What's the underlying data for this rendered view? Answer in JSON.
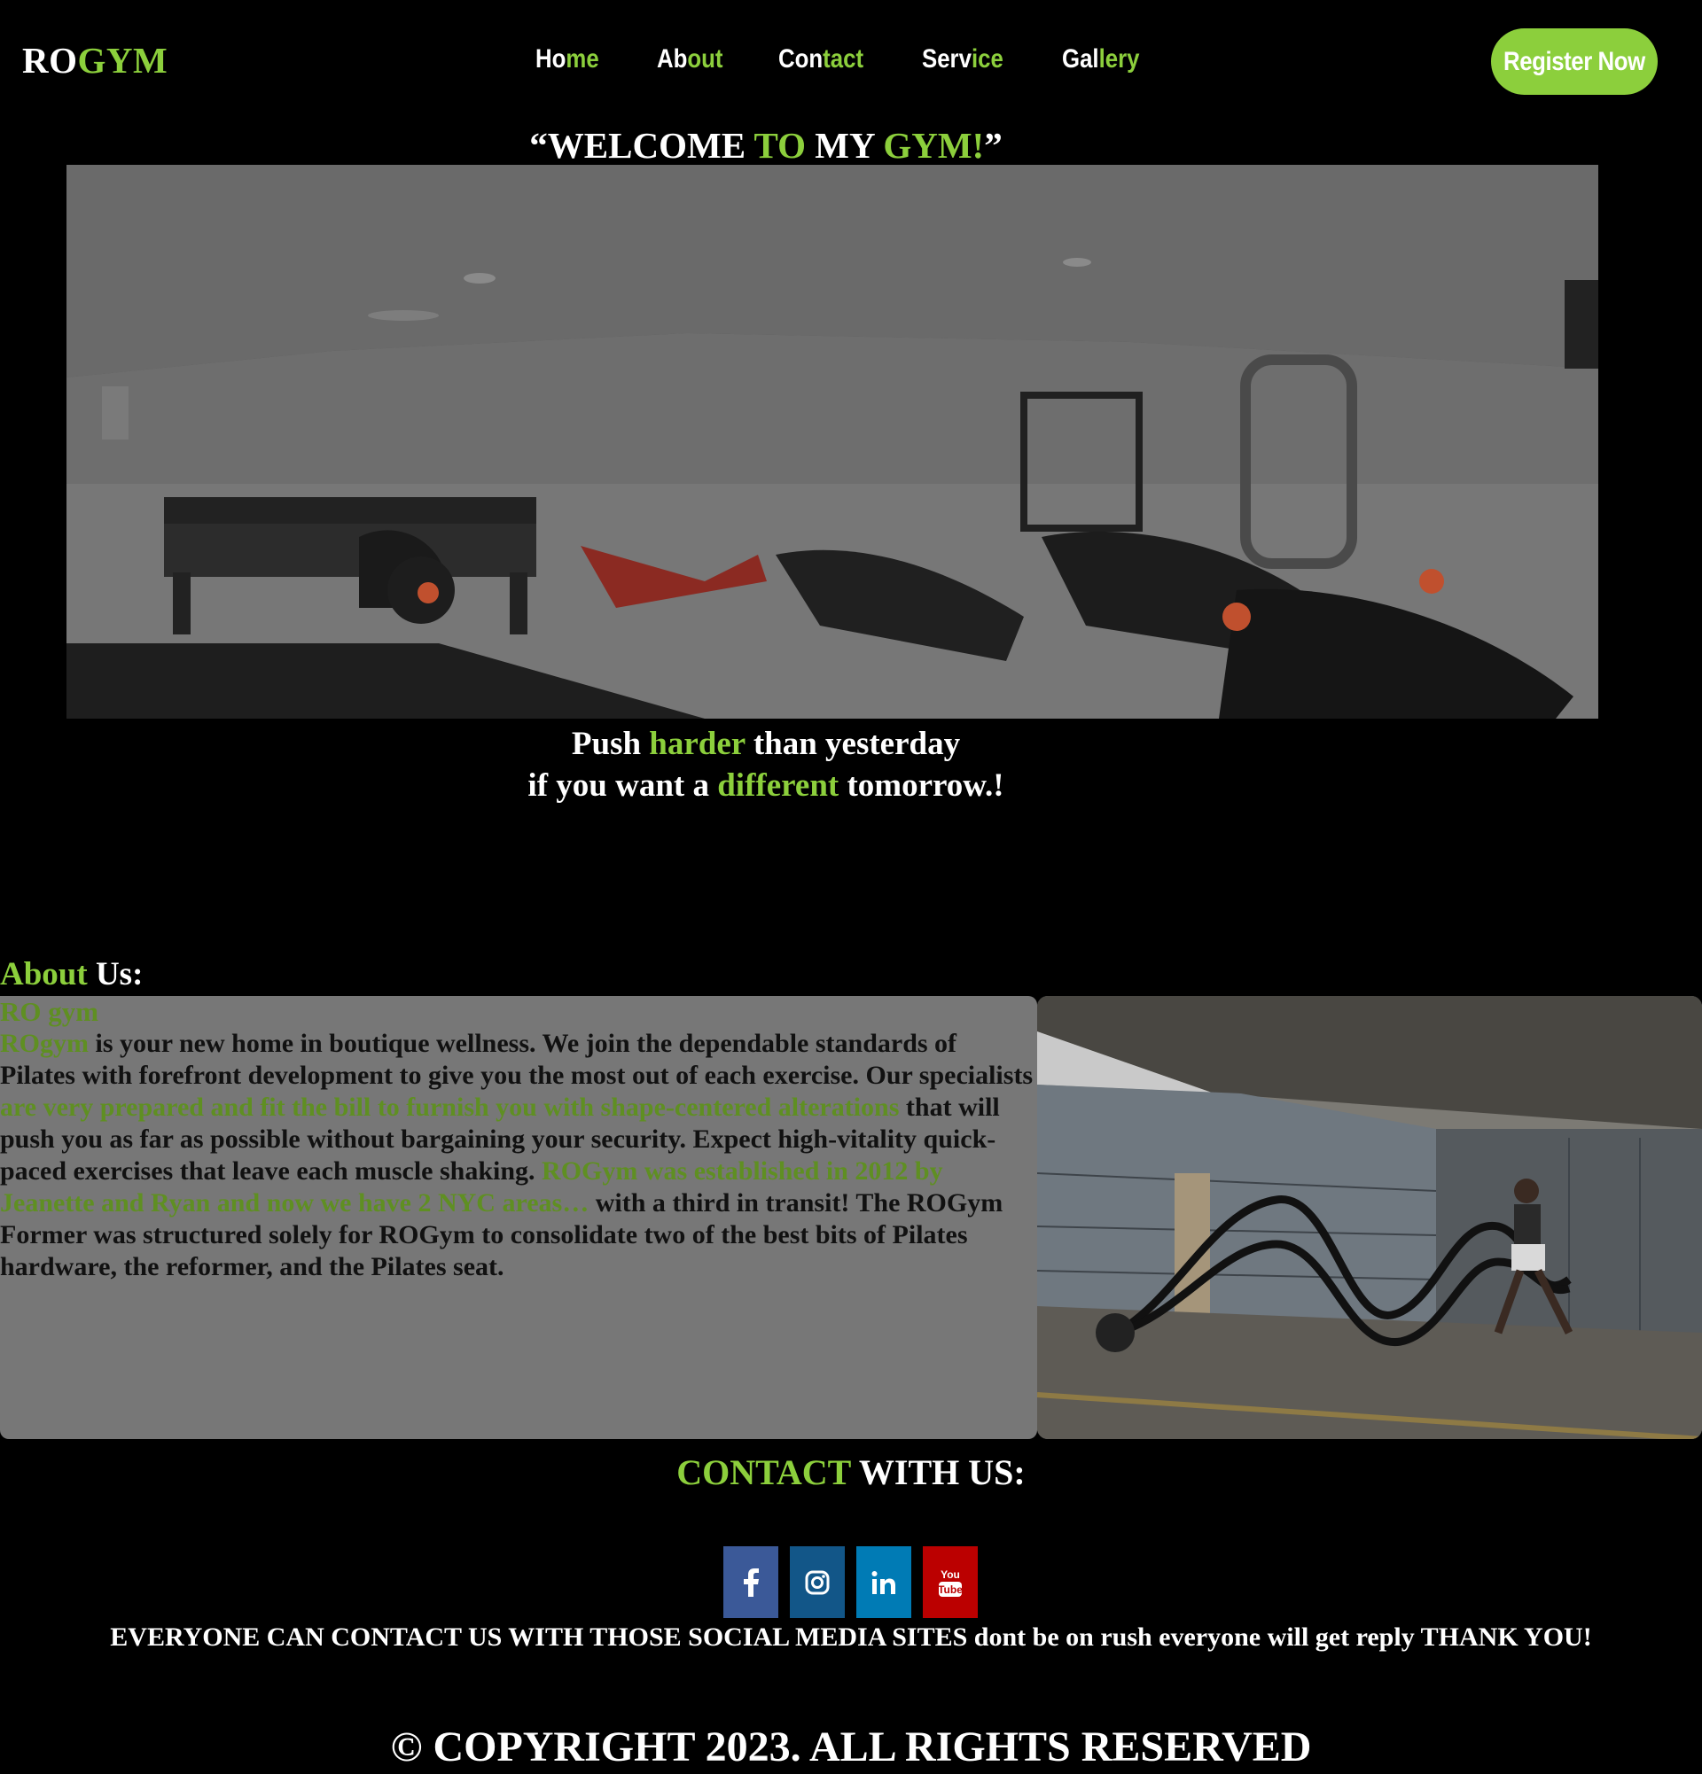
{
  "header": {
    "logo": {
      "part1": "RO",
      "part2": "GYM"
    },
    "nav": [
      {
        "a": "Ho",
        "b": "me"
      },
      {
        "a": "Ab",
        "b": "out"
      },
      {
        "a": "Con",
        "b": "tact"
      },
      {
        "a": "Serv",
        "b": "ice"
      },
      {
        "a": "Gal",
        "b": "lery"
      }
    ],
    "register_label": "Register Now"
  },
  "hero": {
    "welcome": {
      "q1": "“WELCOME ",
      "to": "TO",
      "my": " MY ",
      "gym": "GYM!",
      "q2": "”"
    },
    "slogan_line1": {
      "a": "Push ",
      "b": "harder",
      "c": " than yesterday"
    },
    "slogan_line2": {
      "a": "if you want a ",
      "b": "different",
      "c": " tomorrow.!"
    }
  },
  "about": {
    "title": {
      "a": "About",
      "b": " Us:"
    },
    "subtitle": "RO gym",
    "text": {
      "t1": "ROgym",
      "t2": " is your new home in boutique wellness. We join the dependable standards of Pilates with forefront development to give you the most out of each exercise. Our specialists ",
      "t3": "are very prepared and fit the bill to furnish you with shape-centered alterations",
      "t4": " that will push you as far as possible without bargaining your security. Expect high-vitality quick-paced exercises that leave each muscle shaking. ",
      "t5": "ROGym was established in 2012 by Jeanette and Ryan and now we have 2 NYC areas…",
      "t6": " with a third in transit! The ROGym Former was structured solely for ROGym to consolidate two of the best bits of Pilates hardware, the reformer, and the Pilates seat."
    }
  },
  "contact": {
    "title": {
      "a": "CONTACT",
      "b": " WITH US:"
    },
    "socials": [
      {
        "icon": "facebook-icon",
        "color": "#3b5998"
      },
      {
        "icon": "instagram-icon",
        "color": "#125688"
      },
      {
        "icon": "linkedin-icon",
        "color": "#007bb5"
      },
      {
        "icon": "youtube-icon",
        "color": "#bb0000"
      }
    ],
    "note": "EVERYONE CAN CONTACT US WITH THOSE SOCIAL MEDIA SITES dont be on rush everyone will get reply THANK YOU!"
  },
  "footer": {
    "copyright": "© COPYRIGHT 2023. ALL RIGHTS RESERVED"
  },
  "colors": {
    "accent": "#8ccf3c",
    "background": "#000000",
    "about_box": "#777777"
  }
}
